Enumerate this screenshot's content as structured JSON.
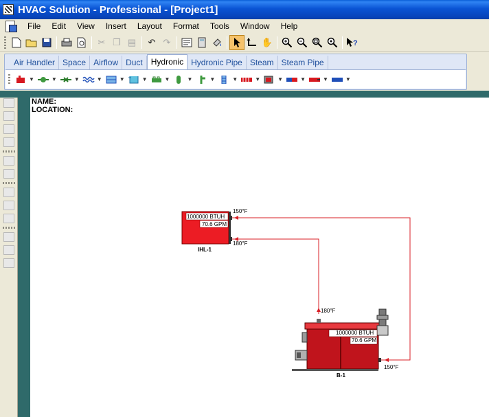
{
  "window": {
    "title": "HVAC Solution - Professional - [Project1]"
  },
  "menu": [
    "File",
    "Edit",
    "View",
    "Insert",
    "Layout",
    "Format",
    "Tools",
    "Window",
    "Help"
  ],
  "toolbar": {
    "buttons": [
      "new-icon",
      "open-icon",
      "save-icon",
      "print-icon",
      "print-preview-icon",
      "cut-icon",
      "copy-icon",
      "paste-icon",
      "undo-icon",
      "redo-icon",
      "properties-icon",
      "calculator-icon",
      "paint-icon",
      "select-pointer-icon",
      "connect-pipe-icon",
      "pan-hand-icon",
      "zoom-in-icon",
      "zoom-out-icon",
      "zoom-window-icon",
      "zoom-fit-icon",
      "whats-this-help-icon"
    ]
  },
  "tabs": {
    "items": [
      "Air Handler",
      "Space",
      "Airflow",
      "Duct",
      "Hydronic",
      "Hydronic Pipe",
      "Steam",
      "Steam Pipe"
    ],
    "selected": "Hydronic"
  },
  "drawing": {
    "name_label": "NAME:",
    "location_label": "LOCATION:",
    "load": {
      "tag": "IHL-1",
      "capacity": "1000000 BTUH",
      "flow": "70.6 GPM",
      "supply_temp": "150°F",
      "return_temp": "180°F",
      "color": "#ec1c24"
    },
    "boiler": {
      "tag": "B-1",
      "capacity": "1000000 BTUH",
      "flow": "70.6 GPM",
      "outlet_temp": "180°F",
      "inlet_temp": "150°F",
      "color": "#c0141c"
    },
    "pipe_color": "#d91f26"
  }
}
